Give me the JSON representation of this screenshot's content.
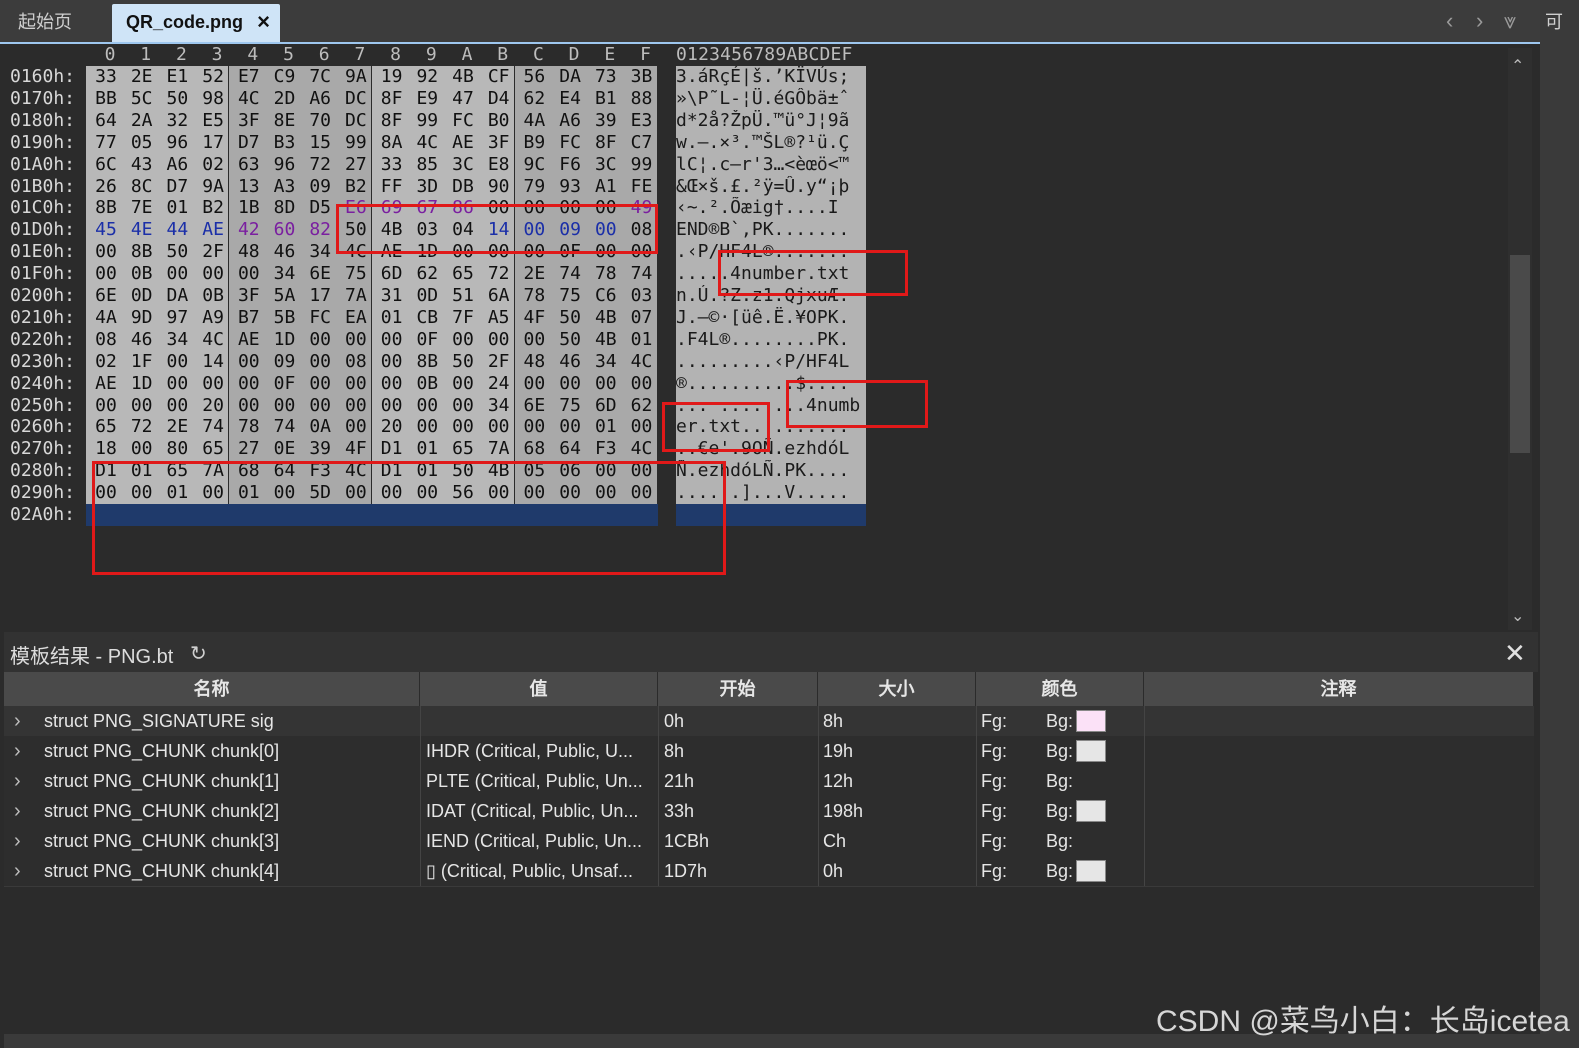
{
  "tabs": {
    "home": "起始页",
    "active": "QR_code.png",
    "close": "×"
  },
  "sidebar_right_label": "可",
  "hex": {
    "columns": [
      "0",
      "1",
      "2",
      "3",
      "4",
      "5",
      "6",
      "7",
      "8",
      "9",
      "A",
      "B",
      "C",
      "D",
      "E",
      "F"
    ],
    "ascii_header": "0123456789ABCDEF",
    "rows": [
      {
        "addr": "0160h:",
        "bytes": [
          "33",
          "2E",
          "E1",
          "52",
          "E7",
          "C9",
          "7C",
          "9A",
          "19",
          "92",
          "4B",
          "CF",
          "56",
          "DA",
          "73",
          "3B"
        ],
        "ascii": "3.áRçÉ|š.’KÏVÚs;"
      },
      {
        "addr": "0170h:",
        "bytes": [
          "BB",
          "5C",
          "50",
          "98",
          "4C",
          "2D",
          "A6",
          "DC",
          "8F",
          "E9",
          "47",
          "D4",
          "62",
          "E4",
          "B1",
          "88"
        ],
        "ascii": "»\\P˜L-¦Ü.éGÔbä±ˆ"
      },
      {
        "addr": "0180h:",
        "bytes": [
          "64",
          "2A",
          "32",
          "E5",
          "3F",
          "8E",
          "70",
          "DC",
          "8F",
          "99",
          "FC",
          "B0",
          "4A",
          "A6",
          "39",
          "E3"
        ],
        "ascii": "d*2å?ŽpÜ.™ü°J¦9ã"
      },
      {
        "addr": "0190h:",
        "bytes": [
          "77",
          "05",
          "96",
          "17",
          "D7",
          "B3",
          "15",
          "99",
          "8A",
          "4C",
          "AE",
          "3F",
          "B9",
          "FC",
          "8F",
          "C7"
        ],
        "ascii": "w.–.×³.™ŠL®?¹ü.Ç"
      },
      {
        "addr": "01A0h:",
        "bytes": [
          "6C",
          "43",
          "A6",
          "02",
          "63",
          "96",
          "72",
          "27",
          "33",
          "85",
          "3C",
          "E8",
          "9C",
          "F6",
          "3C",
          "99"
        ],
        "ascii": "lC¦.c–r'3…<èœö<™"
      },
      {
        "addr": "01B0h:",
        "bytes": [
          "26",
          "8C",
          "D7",
          "9A",
          "13",
          "A3",
          "09",
          "B2",
          "FF",
          "3D",
          "DB",
          "90",
          "79",
          "93",
          "A1",
          "FE"
        ],
        "ascii": "&Œ×š.£.²ÿ=Û.y“¡þ"
      },
      {
        "addr": "01C0h:",
        "bytes": [
          "8B",
          "7E",
          "01",
          "B2",
          "1B",
          "8D",
          "D5",
          "E6",
          "69",
          "67",
          "86",
          "00",
          "00",
          "00",
          "00",
          "49"
        ],
        "ascii": "‹~.².Õæig†....I"
      },
      {
        "addr": "01D0h:",
        "bytes": [
          "45",
          "4E",
          "44",
          "AE",
          "42",
          "60",
          "82",
          "50",
          "4B",
          "03",
          "04",
          "14",
          "00",
          "09",
          "00",
          "08"
        ],
        "ascii": "END®B`‚PK......."
      },
      {
        "addr": "01E0h:",
        "bytes": [
          "00",
          "8B",
          "50",
          "2F",
          "48",
          "46",
          "34",
          "4C",
          "AE",
          "1D",
          "00",
          "00",
          "00",
          "0F",
          "00",
          "00"
        ],
        "ascii": ".‹P/HF4L®......."
      },
      {
        "addr": "01F0h:",
        "bytes": [
          "00",
          "0B",
          "00",
          "00",
          "00",
          "34",
          "6E",
          "75",
          "6D",
          "62",
          "65",
          "72",
          "2E",
          "74",
          "78",
          "74"
        ],
        "ascii": ".....4number.txt"
      },
      {
        "addr": "0200h:",
        "bytes": [
          "6E",
          "0D",
          "DA",
          "0B",
          "3F",
          "5A",
          "17",
          "7A",
          "31",
          "0D",
          "51",
          "6A",
          "78",
          "75",
          "C6",
          "03"
        ],
        "ascii": "n.Ú.?Z.z1.QjxuÆ."
      },
      {
        "addr": "0210h:",
        "bytes": [
          "4A",
          "9D",
          "97",
          "A9",
          "B7",
          "5B",
          "FC",
          "EA",
          "01",
          "CB",
          "7F",
          "A5",
          "4F",
          "50",
          "4B",
          "07"
        ],
        "ascii": "J.—©·[üê.Ë.¥OPK."
      },
      {
        "addr": "0220h:",
        "bytes": [
          "08",
          "46",
          "34",
          "4C",
          "AE",
          "1D",
          "00",
          "00",
          "00",
          "0F",
          "00",
          "00",
          "00",
          "50",
          "4B",
          "01"
        ],
        "ascii": ".F4L®........PK."
      },
      {
        "addr": "0230h:",
        "bytes": [
          "02",
          "1F",
          "00",
          "14",
          "00",
          "09",
          "00",
          "08",
          "00",
          "8B",
          "50",
          "2F",
          "48",
          "46",
          "34",
          "4C"
        ],
        "ascii": ".........‹P/HF4L"
      },
      {
        "addr": "0240h:",
        "bytes": [
          "AE",
          "1D",
          "00",
          "00",
          "00",
          "0F",
          "00",
          "00",
          "00",
          "0B",
          "00",
          "24",
          "00",
          "00",
          "00",
          "00"
        ],
        "ascii": "®..........$...."
      },
      {
        "addr": "0250h:",
        "bytes": [
          "00",
          "00",
          "00",
          "20",
          "00",
          "00",
          "00",
          "00",
          "00",
          "00",
          "00",
          "34",
          "6E",
          "75",
          "6D",
          "62"
        ],
        "ascii": "... ........4numb"
      },
      {
        "addr": "0260h:",
        "bytes": [
          "65",
          "72",
          "2E",
          "74",
          "78",
          "74",
          "0A",
          "00",
          "20",
          "00",
          "00",
          "00",
          "00",
          "00",
          "01",
          "00"
        ],
        "ascii": "er.txt.. ......."
      },
      {
        "addr": "0270h:",
        "bytes": [
          "18",
          "00",
          "80",
          "65",
          "27",
          "0E",
          "39",
          "4F",
          "D1",
          "01",
          "65",
          "7A",
          "68",
          "64",
          "F3",
          "4C"
        ],
        "ascii": "..€e'.9OÑ.ezhdóL"
      },
      {
        "addr": "0280h:",
        "bytes": [
          "D1",
          "01",
          "65",
          "7A",
          "68",
          "64",
          "F3",
          "4C",
          "D1",
          "01",
          "50",
          "4B",
          "05",
          "06",
          "00",
          "00"
        ],
        "ascii": "Ñ.ezhdóLÑ.PK...."
      },
      {
        "addr": "0290h:",
        "bytes": [
          "00",
          "00",
          "01",
          "00",
          "01",
          "00",
          "5D",
          "00",
          "00",
          "00",
          "56",
          "00",
          "00",
          "00",
          "00",
          "00"
        ],
        "ascii": "......]...V....."
      },
      {
        "addr": "02A0h:",
        "bytes": [],
        "ascii": ""
      }
    ]
  },
  "template": {
    "title": "模板结果 - PNG.bt",
    "refresh_icon": "↻",
    "close_icon": "✕",
    "headers": [
      "名称",
      "值",
      "开始",
      "大小",
      "颜色",
      "注释"
    ],
    "rows": [
      {
        "name": "struct PNG_SIGNATURE sig",
        "value": "",
        "start": "0h",
        "size": "8h",
        "fg": "Fg:",
        "bg": "Bg:",
        "bg_color": "#fbe1f7"
      },
      {
        "name": "struct PNG_CHUNK chunk[0]",
        "value": "IHDR  (Critical, Public, U...",
        "start": "8h",
        "size": "19h",
        "fg": "Fg:",
        "bg": "Bg:",
        "bg_color": "#e6e6e6"
      },
      {
        "name": "struct PNG_CHUNK chunk[1]",
        "value": "PLTE  (Critical, Public, Un...",
        "start": "21h",
        "size": "12h",
        "fg": "Fg:",
        "bg": "Bg:",
        "bg_color": ""
      },
      {
        "name": "struct PNG_CHUNK chunk[2]",
        "value": "IDAT  (Critical, Public, Un...",
        "start": "33h",
        "size": "198h",
        "fg": "Fg:",
        "bg": "Bg:",
        "bg_color": "#e6e6e6"
      },
      {
        "name": "struct PNG_CHUNK chunk[3]",
        "value": "IEND  (Critical, Public, Un...",
        "start": "1CBh",
        "size": "Ch",
        "fg": "Fg:",
        "bg": "Bg:",
        "bg_color": ""
      },
      {
        "name": "struct PNG_CHUNK chunk[4]",
        "value": "▯  (Critical, Public, Unsaf...",
        "start": "1D7h",
        "size": "0h",
        "fg": "Fg:",
        "bg": "Bg:",
        "bg_color": "#e6e6e6"
      }
    ]
  },
  "watermark": "CSDN @菜鸟小白：长岛icetea",
  "colors": {
    "accent_tab": "#cfe4f7",
    "highlight_red": "#e01919",
    "selection": "#1f3a6b",
    "iend_text": "#7a1fa0",
    "pk_text": "#1b2fa8"
  }
}
